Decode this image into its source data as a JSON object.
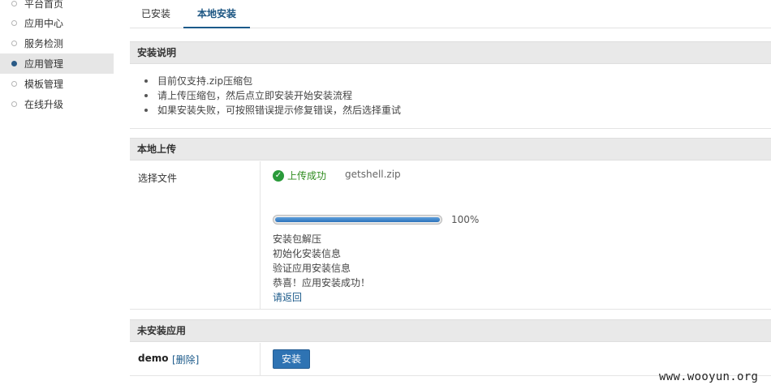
{
  "sidebar": {
    "items": [
      {
        "label": "平台首页",
        "active": false
      },
      {
        "label": "应用中心",
        "active": false
      },
      {
        "label": "服务检测",
        "active": false
      },
      {
        "label": "应用管理",
        "active": true
      },
      {
        "label": "模板管理",
        "active": false
      },
      {
        "label": "在线升级",
        "active": false
      }
    ]
  },
  "tabs": [
    {
      "label": "已安装",
      "active": false
    },
    {
      "label": "本地安装",
      "active": true
    }
  ],
  "instructions": {
    "title": "安装说明",
    "items": [
      "目前仅支持.zip压缩包",
      "请上传压缩包，然后点立即安装开始安装流程",
      "如果安装失败，可按照错误提示修复错误，然后选择重试"
    ]
  },
  "upload": {
    "title": "本地上传",
    "file_label": "选择文件",
    "status_text": "上传成功",
    "filename": "getshell.zip",
    "progress": 1.0,
    "progress_text": "100%",
    "steps": [
      "安装包解压",
      "初始化安装信息",
      "验证应用安装信息",
      "恭喜！应用安装成功！"
    ],
    "back_link": "请返回"
  },
  "uninstalled": {
    "title": "未安装应用",
    "app_name": "demo",
    "delete_label": "[删除]",
    "install_label": "安装"
  },
  "watermark": "www.wooyun.org",
  "colors": {
    "accent": "#1b5a8a",
    "success": "#2e8b1e",
    "button": "#2e73b3"
  }
}
